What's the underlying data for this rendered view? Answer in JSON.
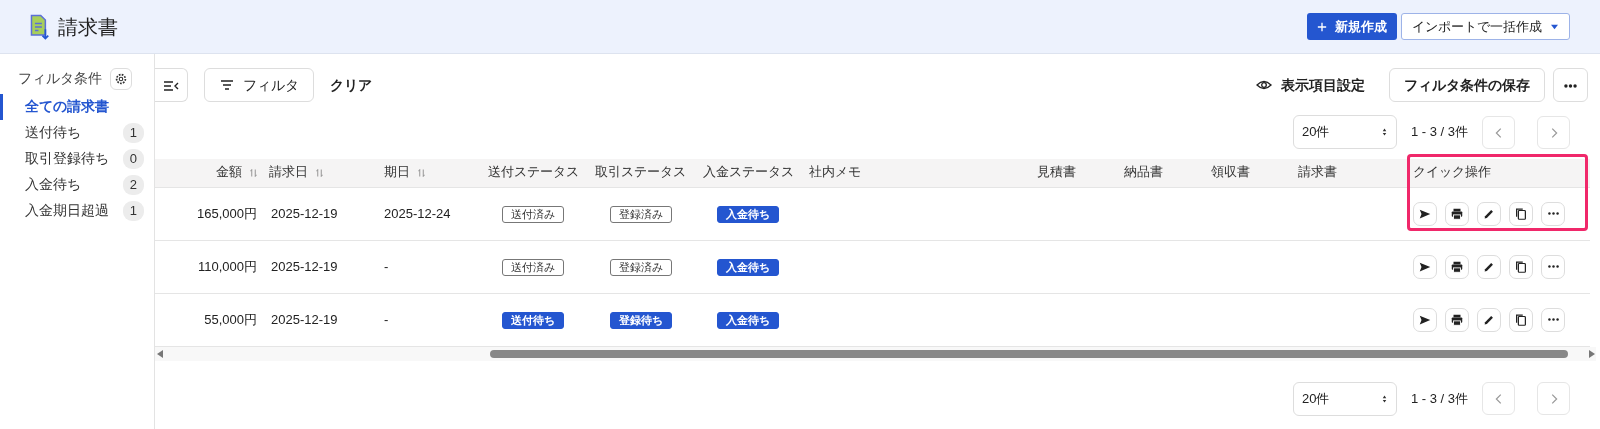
{
  "header": {
    "title": "請求書",
    "buttons": [
      {
        "kind": "primary",
        "label": "新規作成"
      },
      {
        "kind": "dropdown",
        "label": "インポートで一括作成"
      }
    ]
  },
  "sidebar": {
    "title": "フィルタ条件",
    "items": [
      {
        "label": "全ての請求書",
        "selected": true
      },
      {
        "label": "送付待ち",
        "count": "1",
        "selected": false
      },
      {
        "label": "取引登録待ち",
        "count": "0",
        "selected": false
      },
      {
        "label": "入金待ち",
        "count": "2",
        "selected": false
      },
      {
        "label": "入金期日超過",
        "count": "1",
        "selected": false
      }
    ]
  },
  "toolbar": {
    "filter": "フィルタ",
    "clear": "クリア",
    "columns_setting": "表示項目設定",
    "save_filter": "フィルタ条件の保存"
  },
  "pagination_top": {
    "page_size": "20件",
    "range": "1 - 3 / 3件"
  },
  "table": {
    "columns": [
      {
        "label": "金額",
        "sortable": true
      },
      {
        "label": "請求日",
        "sortable": true
      },
      {
        "label": "期日",
        "sortable": true
      },
      {
        "label": "送付ステータス",
        "sortable": false
      },
      {
        "label": "取引ステータス",
        "sortable": false
      },
      {
        "label": "入金ステータス",
        "sortable": false
      },
      {
        "label": "社内メモ",
        "sortable": false
      },
      {
        "label": "見積書",
        "sortable": false
      },
      {
        "label": "納品書",
        "sortable": false
      },
      {
        "label": "領収書",
        "sortable": false
      },
      {
        "label": "請求書",
        "sortable": false
      },
      {
        "label": "クイック操作",
        "sortable": false,
        "highlighted": true
      }
    ],
    "rows": [
      {
        "amount": "165,000円",
        "issue_date": "2025-12-19",
        "due_date": "2025-12-24",
        "statuses": [
          {
            "label": "送付済み",
            "kind": "outline"
          },
          {
            "label": "登録済み",
            "kind": "outline"
          },
          {
            "label": "入金待ち",
            "kind": "filled"
          }
        ],
        "actions": [
          {
            "kind": "send"
          },
          {
            "kind": "print"
          },
          {
            "kind": "edit"
          },
          {
            "kind": "copy"
          },
          {
            "kind": "more"
          }
        ]
      },
      {
        "amount": "110,000円",
        "issue_date": "2025-12-19",
        "due_date": "-",
        "statuses": [
          {
            "label": "送付済み",
            "kind": "outline"
          },
          {
            "label": "登録済み",
            "kind": "outline"
          },
          {
            "label": "入金待ち",
            "kind": "filled"
          }
        ],
        "actions": [
          {
            "kind": "send"
          },
          {
            "kind": "print"
          },
          {
            "kind": "edit"
          },
          {
            "kind": "copy"
          },
          {
            "kind": "more"
          }
        ]
      },
      {
        "amount": "55,000円",
        "issue_date": "2025-12-19",
        "due_date": "-",
        "statuses": [
          {
            "label": "送付待ち",
            "kind": "filled"
          },
          {
            "label": "登録待ち",
            "kind": "filled"
          },
          {
            "label": "入金待ち",
            "kind": "filled"
          }
        ],
        "actions": [
          {
            "kind": "send"
          },
          {
            "kind": "print"
          },
          {
            "kind": "edit"
          },
          {
            "kind": "copy"
          },
          {
            "kind": "more"
          }
        ]
      }
    ]
  },
  "pagination_bottom": {
    "page_size": "20件",
    "range": "1 - 3 / 3件"
  }
}
